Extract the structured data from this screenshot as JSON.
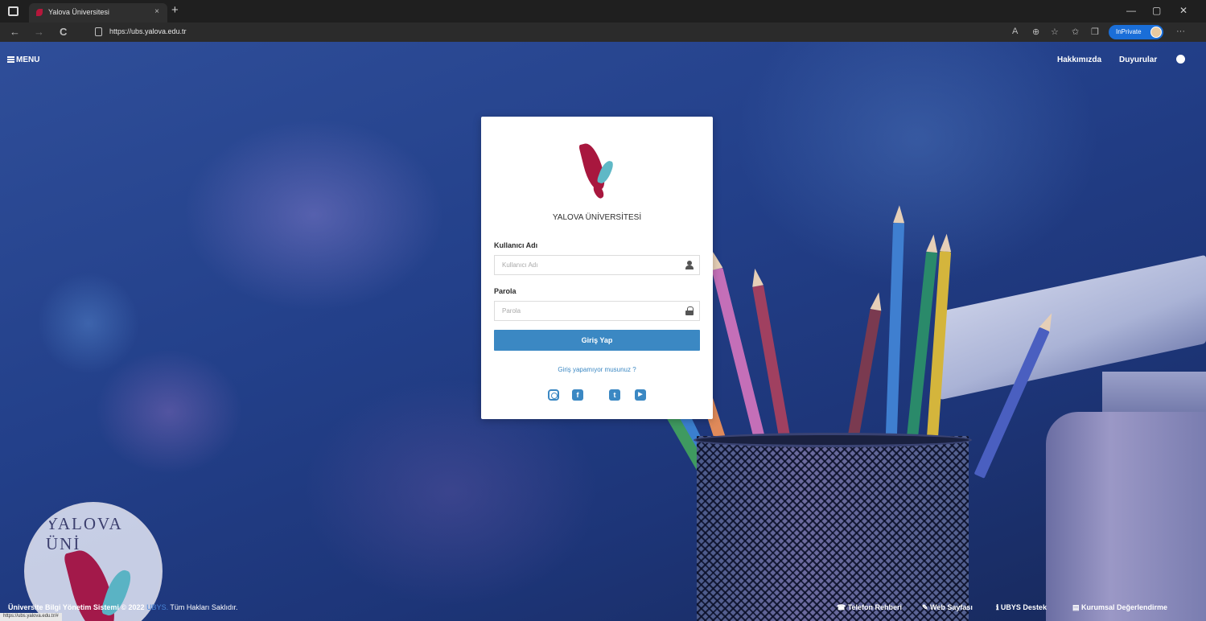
{
  "browser": {
    "tab_title": "Yalova Üniversitesi",
    "tab_close": "×",
    "new_tab": "+",
    "url": "https://ubs.yalova.edu.tr",
    "inprivate_label": "InPrivate",
    "window_controls": [
      "—",
      "▢",
      "✕"
    ],
    "nav": {
      "back": "←",
      "forward": "→",
      "refresh": "C"
    },
    "toolbar_icons": [
      "read-aloud-icon",
      "zoom-icon",
      "favorites-add-icon",
      "favorites-icon",
      "collections-icon",
      "more-icon"
    ]
  },
  "topnav": {
    "menu_label": "MENU",
    "about_label": "Hakkımızda",
    "announcements_label": "Duyurular"
  },
  "login": {
    "university_name": "YALOVA ÜNİVERSİTESİ",
    "username_label": "Kullanıcı Adı",
    "username_placeholder": "Kullanıcı Adı",
    "password_label": "Parola",
    "password_placeholder": "Parola",
    "submit_label": "Giriş Yap",
    "trouble_link": "Giriş yapamıyor musunuz ?",
    "social": {
      "facebook": "f",
      "twitter": "t",
      "youtube": "▶"
    }
  },
  "seal": {
    "arc_text": "YALOVA ÜNİVERSİTESİ"
  },
  "footer": {
    "system_name": "Üniversite Bilgi Yönetim Sistemi",
    "copyright": "© 2022",
    "product": "UBYS.",
    "rights": "Tüm Hakları Saklıdır.",
    "links": {
      "phone_book": "Telefon Rehberi",
      "web_page": "Web Sayfası",
      "support": "UBYS Destek",
      "feedback": "Kurumsal Değerlendirme"
    },
    "status_url": "https://ubs.yalova.edu.tr/#"
  },
  "colors": {
    "brand_red": "#a8173e",
    "brand_teal": "#5fb8c6",
    "button_blue": "#3b88c3",
    "background_navy": "#23408a"
  }
}
